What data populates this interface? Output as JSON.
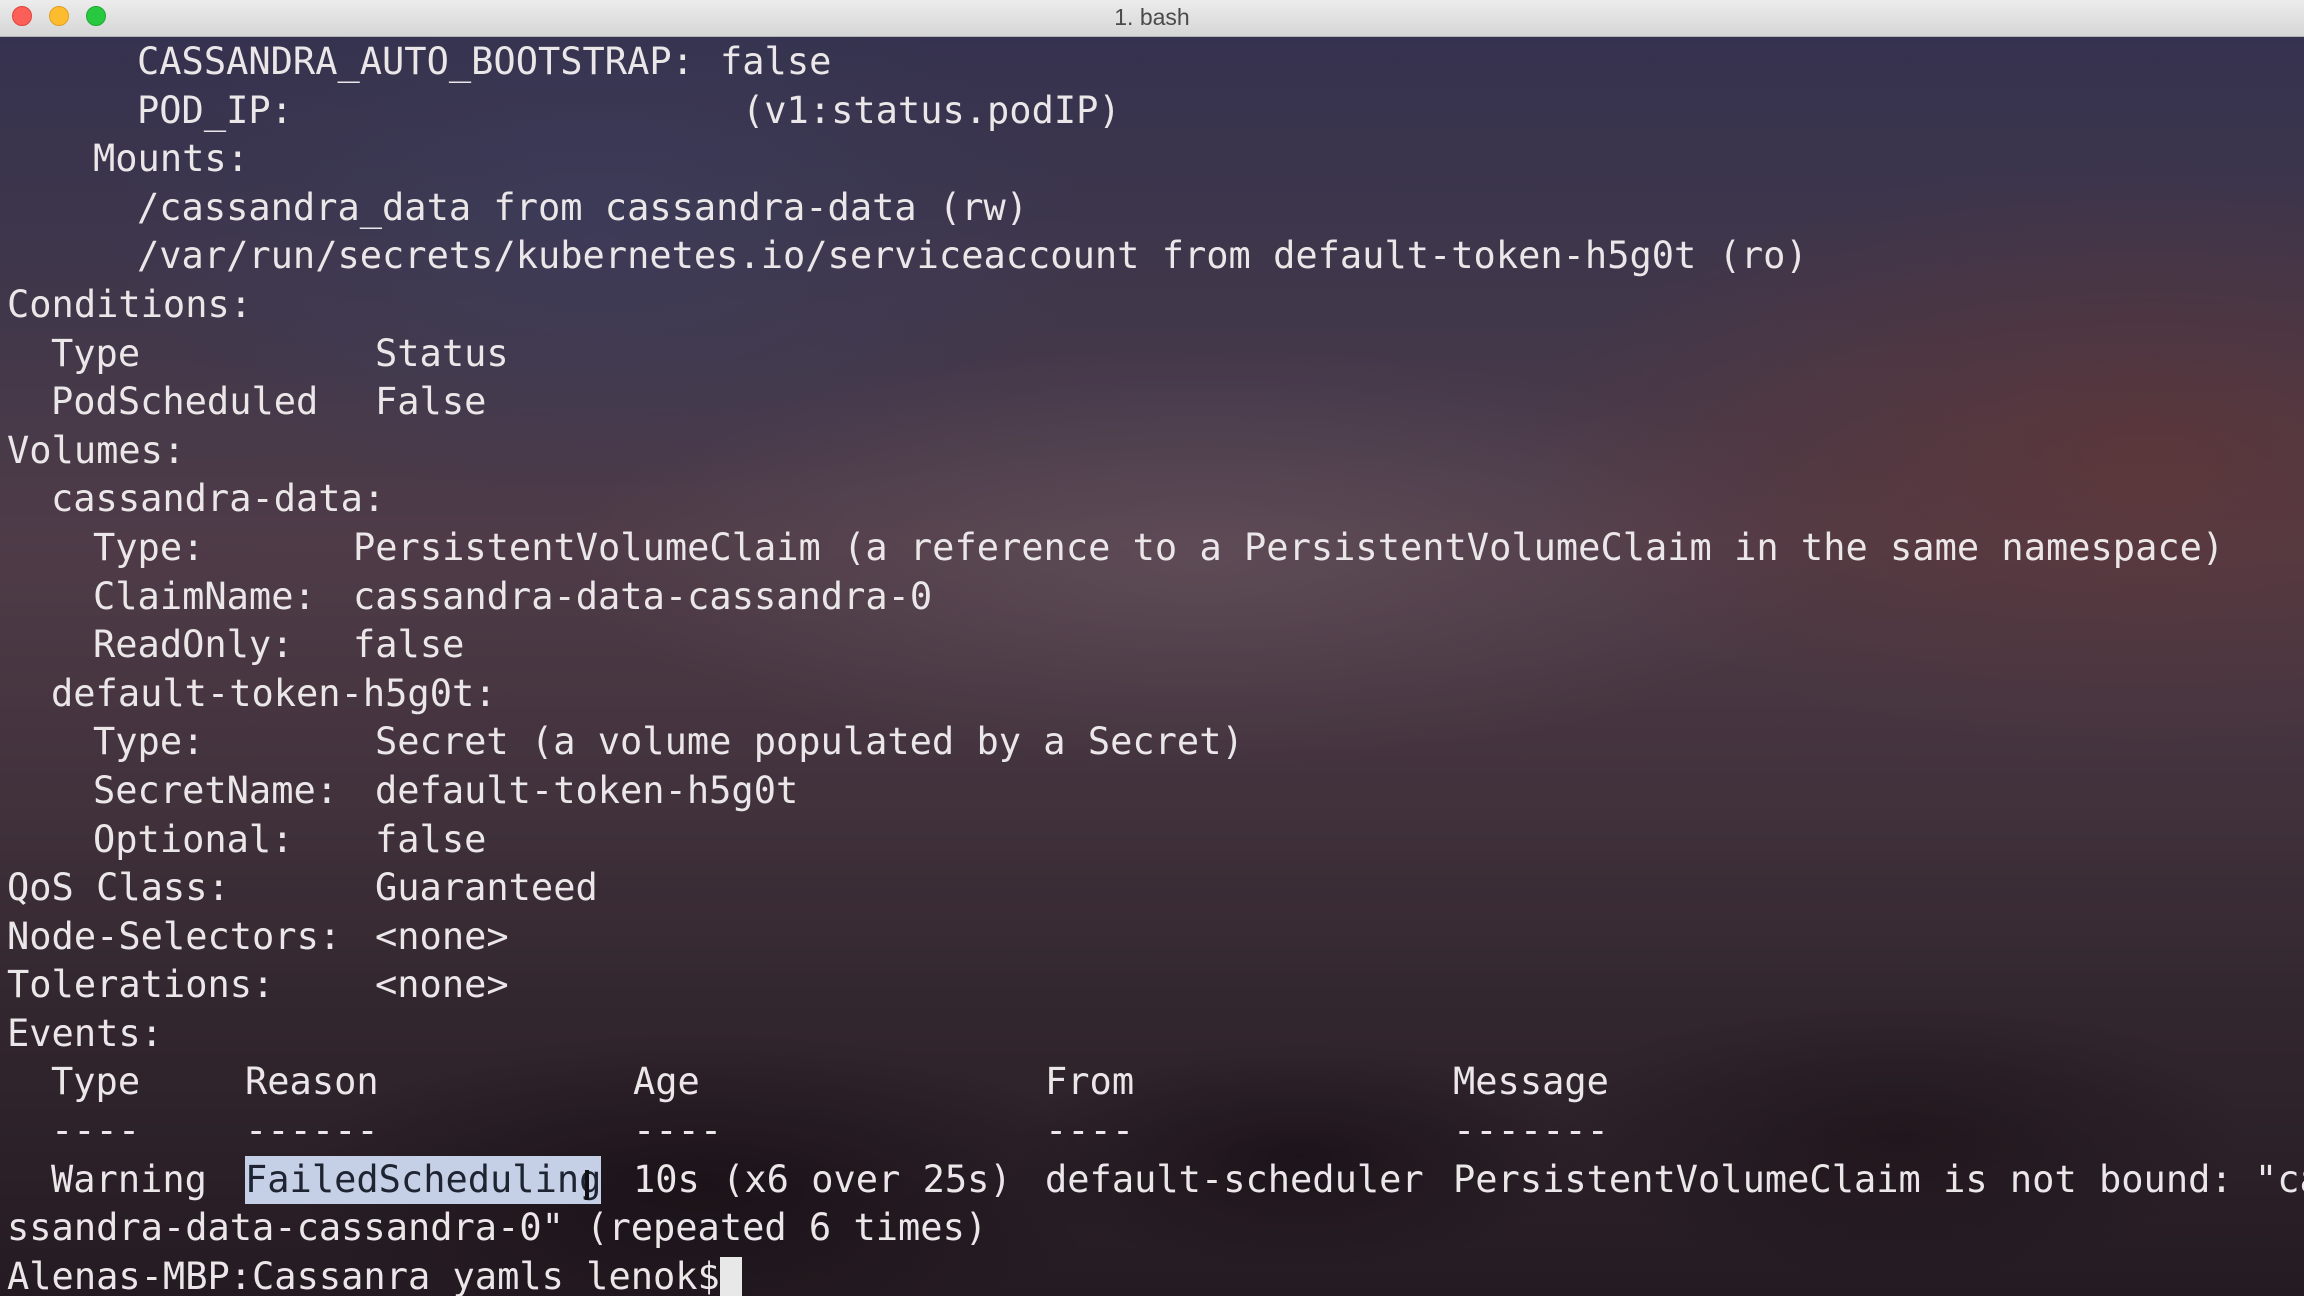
{
  "window": {
    "title": "1. bash"
  },
  "terminal": {
    "cassandra_auto_bootstrap_key": "CASSANDRA_AUTO_BOOTSTRAP:",
    "cassandra_auto_bootstrap_val": "false",
    "pod_ip_key": "POD_IP:",
    "pod_ip_val": "(v1:status.podIP)",
    "mounts_key": "Mounts:",
    "mount_1": "/cassandra_data from cassandra-data (rw)",
    "mount_2": "/var/run/secrets/kubernetes.io/serviceaccount from default-token-h5g0t (ro)",
    "conditions_key": "Conditions:",
    "conditions_header_type": "Type",
    "conditions_header_status": "Status",
    "condition_type": "PodScheduled",
    "condition_status": "False",
    "volumes_key": "Volumes:",
    "vol1_name": "cassandra-data:",
    "vol1_type_key": "Type:",
    "vol1_type_val": "PersistentVolumeClaim (a reference to a PersistentVolumeClaim in the same namespace)",
    "vol1_claim_key": "ClaimName:",
    "vol1_claim_val": "cassandra-data-cassandra-0",
    "vol1_readonly_key": "ReadOnly:",
    "vol1_readonly_val": "false",
    "vol2_name": "default-token-h5g0t:",
    "vol2_type_key": "Type:",
    "vol2_type_val": "Secret (a volume populated by a Secret)",
    "vol2_secret_key": "SecretName:",
    "vol2_secret_val": "default-token-h5g0t",
    "vol2_optional_key": "Optional:",
    "vol2_optional_val": "false",
    "qos_key": "QoS Class:",
    "qos_val": "Guaranteed",
    "node_selectors_key": "Node-Selectors:",
    "node_selectors_val": "<none>",
    "tolerations_key": "Tolerations:",
    "tolerations_val": "<none>",
    "events_key": "Events:",
    "events_header": {
      "type": "Type",
      "reason": "Reason",
      "age": "Age",
      "from": "From",
      "message": "Message"
    },
    "events_divider": {
      "type": "----",
      "reason": "------",
      "age": "----",
      "from": "----",
      "message": "-------"
    },
    "event_row": {
      "type": "Warning",
      "reason": "FailedScheduling",
      "age": "10s (x6 over 25s)",
      "from": "default-scheduler",
      "message": "PersistentVolumeClaim is not bound: \"ca"
    },
    "event_row_wrap": "ssandra-data-cassandra-0\" (repeated 6 times)",
    "prompt": "Alenas-MBP:Cassanra yamls lenok$"
  }
}
